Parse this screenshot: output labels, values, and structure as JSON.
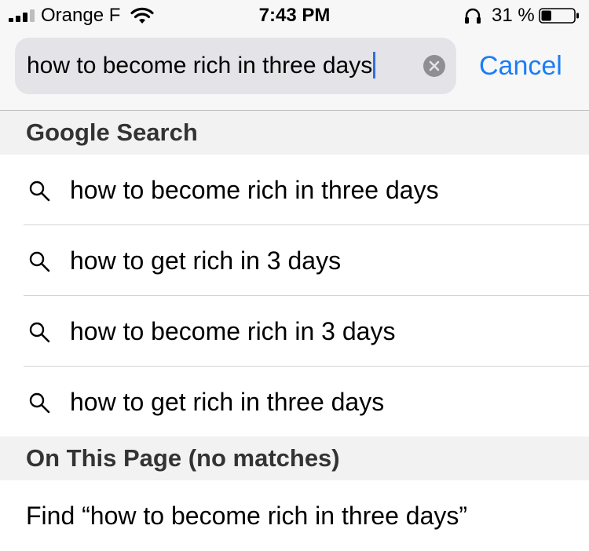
{
  "status_bar": {
    "carrier": "Orange F",
    "time": "7:43 PM",
    "battery_percent": "31 %",
    "battery_level": 0.31,
    "icons": [
      "signal-icon",
      "wifi-icon",
      "headphones-icon",
      "battery-icon"
    ]
  },
  "search": {
    "query": "how to become rich in three days",
    "cancel_label": "Cancel",
    "clear_icon": "clear-icon"
  },
  "sections": {
    "google_search": {
      "title": "Google Search",
      "suggestions": [
        {
          "text": "how to become rich in three days",
          "icon": "magnifier-icon"
        },
        {
          "text": "how to get rich in 3 days",
          "icon": "magnifier-icon"
        },
        {
          "text": "how to become rich in 3 days",
          "icon": "magnifier-icon"
        },
        {
          "text": "how to get rich in three days",
          "icon": "magnifier-icon"
        }
      ]
    },
    "on_this_page": {
      "title": "On This Page (no matches)",
      "find_label": "Find “how to become rich in three days”"
    }
  },
  "colors": {
    "accent": "#1a7ef5",
    "caret": "#2f6fe0",
    "bar_background": "#f7f7f7",
    "field_background": "#e3e3e8",
    "section_background": "#f2f2f2"
  }
}
